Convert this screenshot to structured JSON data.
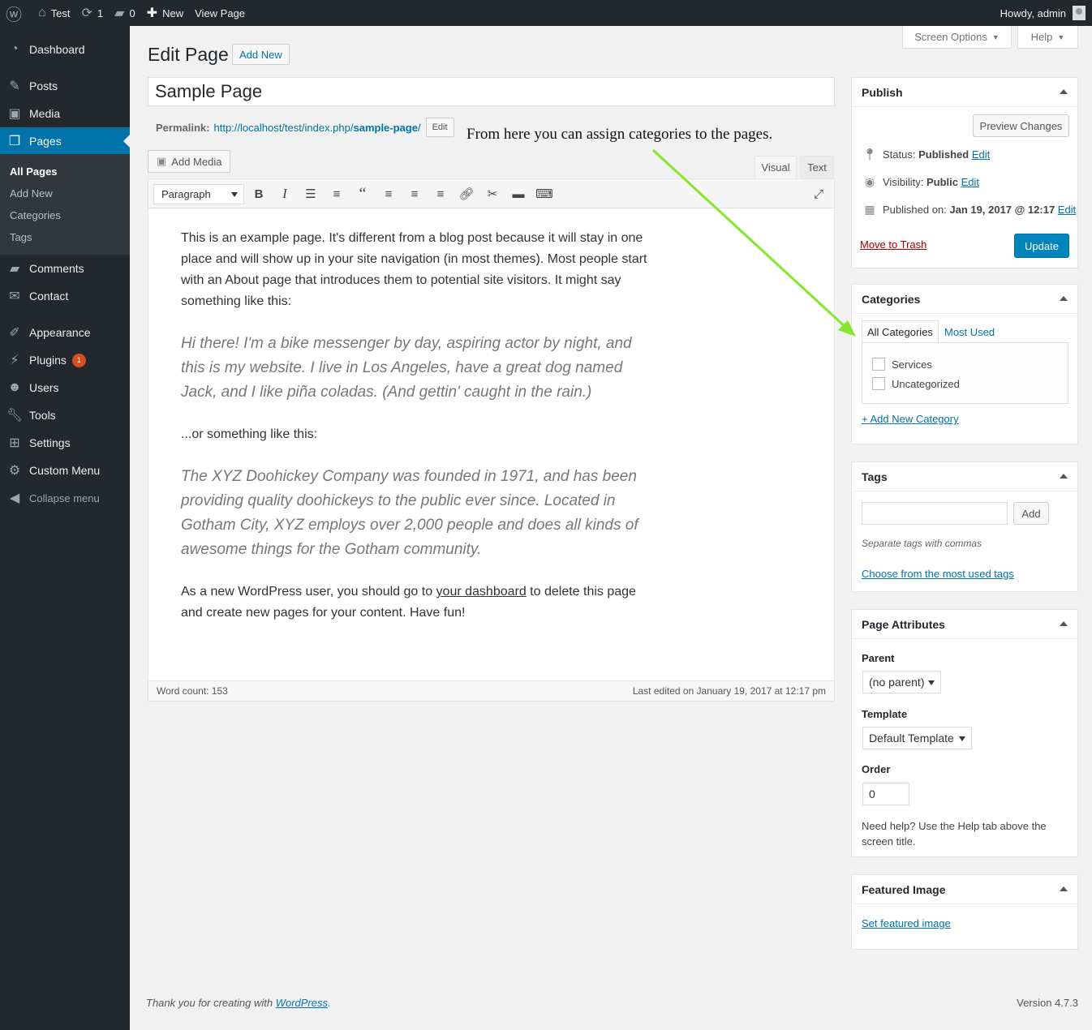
{
  "adminbar": {
    "site_name": "Test",
    "updates_count": "1",
    "comments_count": "0",
    "new_label": "New",
    "view_page": "View Page",
    "howdy": "Howdy, admin"
  },
  "sidebar": {
    "items": [
      {
        "label": "Dashboard",
        "icon": "dashboard-icon"
      },
      {
        "label": "Posts",
        "icon": "pin-icon"
      },
      {
        "label": "Media",
        "icon": "media-icon"
      },
      {
        "label": "Pages",
        "icon": "pages-icon"
      },
      {
        "label": "Comments",
        "icon": "comment-icon"
      },
      {
        "label": "Contact",
        "icon": "mail-icon"
      },
      {
        "label": "Appearance",
        "icon": "brush-icon"
      },
      {
        "label": "Plugins",
        "icon": "plugin-icon",
        "badge": "1"
      },
      {
        "label": "Users",
        "icon": "users-icon"
      },
      {
        "label": "Tools",
        "icon": "wrench-icon"
      },
      {
        "label": "Settings",
        "icon": "settings-icon"
      },
      {
        "label": "Custom Menu",
        "icon": "gear-icon"
      },
      {
        "label": "Collapse menu",
        "icon": "collapse-icon"
      }
    ],
    "submenu": [
      "All Pages",
      "Add New",
      "Categories",
      "Tags"
    ]
  },
  "screen_options": "Screen Options",
  "help": "Help",
  "heading": {
    "title": "Edit Page",
    "add_new": "Add New"
  },
  "post_title": "Sample Page",
  "permalink": {
    "label": "Permalink:",
    "url_base": "http://localhost/test/index.php/",
    "slug": "sample-page",
    "url_tail": "/",
    "edit": "Edit"
  },
  "annotation": "From here you can assign categories to the pages.",
  "editor": {
    "add_media": "Add Media",
    "tab_visual": "Visual",
    "tab_text": "Text",
    "format": "Paragraph",
    "content": {
      "p1": "This is an example page. It's different from a blog post because it will stay in one place and will show up in your site navigation (in most themes). Most people start with an About page that introduces them to potential site visitors. It might say something like this:",
      "quote1": "Hi there! I'm a bike messenger by day, aspiring actor by night, and this is my website. I live in Los Angeles, have a great dog named Jack, and I like piña coladas. (And gettin' caught in the rain.)",
      "p2": "...or something like this:",
      "quote2": "The XYZ Doohickey Company was founded in 1971, and has been providing quality doohickeys to the public ever since. Located in Gotham City, XYZ employs over 2,000 people and does all kinds of awesome things for the Gotham community.",
      "p3_before": "As a new WordPress user, you should go to ",
      "p3_link": "your dashboard",
      "p3_after": " to delete this page and create new pages for your content. Have fun!"
    },
    "word_count": "Word count: 153",
    "last_edited": "Last edited on January 19, 2017 at 12:17 pm"
  },
  "publish": {
    "title": "Publish",
    "preview": "Preview Changes",
    "status_label": "Status:",
    "status_value": "Published",
    "visibility_label": "Visibility:",
    "visibility_value": "Public",
    "published_label": "Published on:",
    "published_value": "Jan 19, 2017 @ 12:17",
    "edit": "Edit",
    "trash": "Move to Trash",
    "update": "Update"
  },
  "categories": {
    "title": "Categories",
    "tab_all": "All Categories",
    "tab_most": "Most Used",
    "items": [
      "Services",
      "Uncategorized"
    ],
    "add_new": "+ Add New Category"
  },
  "tags": {
    "title": "Tags",
    "add": "Add",
    "hint": "Separate tags with commas",
    "choose": "Choose from the most used tags"
  },
  "attributes": {
    "title": "Page Attributes",
    "parent_label": "Parent",
    "parent_value": "(no parent)",
    "template_label": "Template",
    "template_value": "Default Template",
    "order_label": "Order",
    "order_value": "0",
    "help": "Need help? Use the Help tab above the screen title."
  },
  "featured": {
    "title": "Featured Image",
    "set": "Set featured image"
  },
  "footer": {
    "thanks_before": "Thank you for creating with ",
    "thanks_link": "WordPress",
    "thanks_after": ".",
    "version": "Version 4.7.3"
  },
  "colors": {
    "accent": "#0073aa",
    "primary_button": "#0085ba",
    "arrow": "#86e62f",
    "trash": "#a00",
    "sidebar": "#23282d"
  }
}
